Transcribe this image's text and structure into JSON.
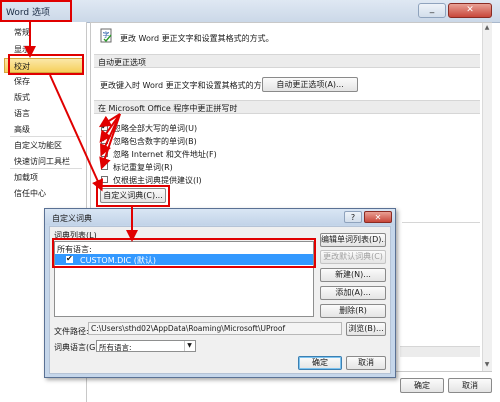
{
  "main_window": {
    "title": "Word 选项",
    "min_glyph": "_",
    "close_glyph": "✕"
  },
  "nav": {
    "items": [
      {
        "label": "常规"
      },
      {
        "label": "显示"
      },
      {
        "label": "校对"
      },
      {
        "label": "保存"
      },
      {
        "label": "版式"
      },
      {
        "label": "语言"
      },
      {
        "label": "高级"
      },
      {
        "label": "自定义功能区"
      },
      {
        "label": "快速访问工具栏"
      },
      {
        "label": "加载项"
      },
      {
        "label": "信任中心"
      }
    ]
  },
  "content": {
    "header_text": "更改 Word 更正文字和设置其格式的方式。",
    "autocorrect": {
      "section_title": "自动更正选项",
      "label": "更改键入时 Word 更正文字和设置其格式的方式：",
      "button": "自动更正选项(A)..."
    },
    "office": {
      "section_title": "在 Microsoft Office 程序中更正拼写时",
      "options": [
        {
          "label": "忽略全部大写的单词(U)",
          "checked": true
        },
        {
          "label": "忽略包含数字的单词(B)",
          "checked": true
        },
        {
          "label": "忽略 Internet 和文件地址(F)",
          "checked": true
        },
        {
          "label": "标记重复单词(R)",
          "checked": true
        },
        {
          "label": "仅根据主词典提供建议(I)",
          "checked": false
        }
      ],
      "custom_dict_button": "自定义词典(C)..."
    }
  },
  "footer": {
    "ok": "确定",
    "cancel": "取消"
  },
  "dialog": {
    "title": "自定义词典",
    "help_glyph": "?",
    "close_glyph": "✕",
    "list_label": "词典列表(L)",
    "list_group": "所有语言:",
    "list_item": "CUSTOM.DIC (默认)",
    "buttons": {
      "edit_list": "编辑单词列表(D)...",
      "change_default": "更改默认词典(C)",
      "new": "新建(N)...",
      "add": "添加(A)...",
      "remove": "删除(R)"
    },
    "path_label": "文件路径:",
    "path_value": "C:\\Users\\sthd02\\AppData\\Roaming\\Microsoft\\UProof",
    "browse": "浏览(B)...",
    "lang_label": "词典语言(G):",
    "lang_value": "所有语言:",
    "ok": "确定",
    "cancel": "取消"
  }
}
